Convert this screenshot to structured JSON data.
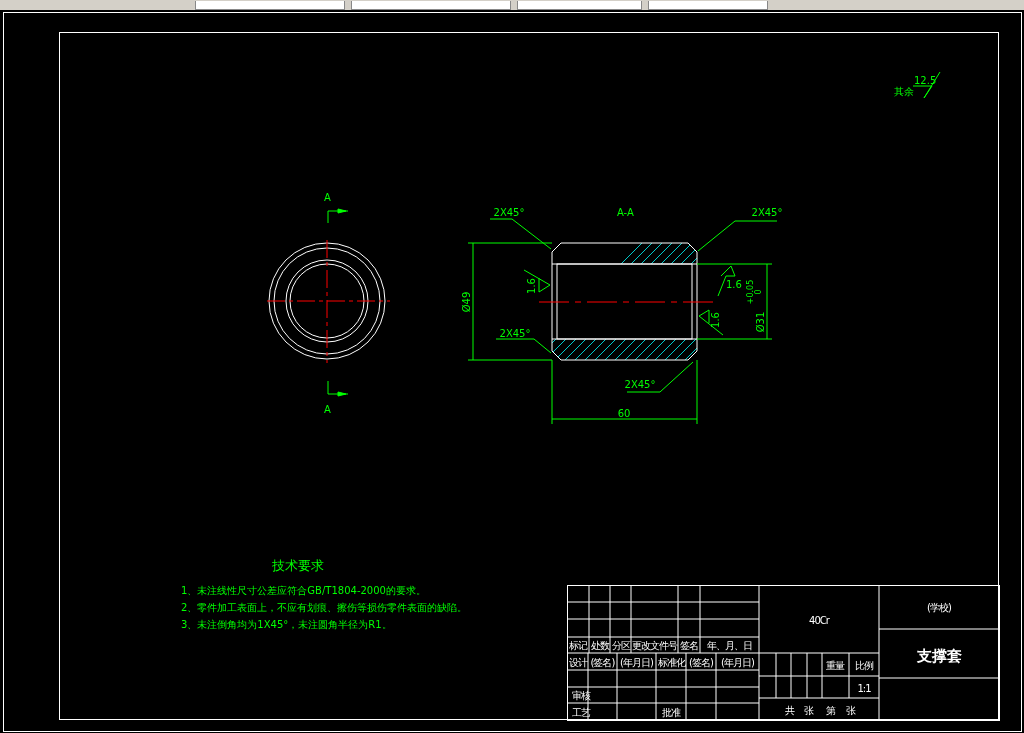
{
  "drawing": {
    "end_view": {
      "cut_labels": [
        "A",
        "A"
      ]
    },
    "section_view": {
      "title": "A-A",
      "chamfers": [
        "2X45°",
        "2X45°",
        "2X45°",
        "2X45°"
      ],
      "outer_diameter": "Ø49",
      "bore_diameter": "Ø31",
      "bore_tolerance_upper": "+0.05",
      "bore_tolerance_lower": "0",
      "length": "60",
      "roughness": [
        "1.6",
        "1.6",
        "1.6"
      ]
    },
    "general_roughness": {
      "label": "其余",
      "value": "12.5"
    }
  },
  "notes": {
    "title": "技术要求",
    "items": [
      "1、未注线性尺寸公差应符合GB/T1804-2000的要求。",
      "2、零件加工表面上，不应有划痕、擦伤等损伤零件表面的缺陷。",
      "3、未注倒角均为1X45°，未注圆角半径为R1。"
    ]
  },
  "title_block": {
    "revision_header": [
      "标记",
      "处数",
      "分区",
      "更改文件号",
      "签名",
      "年、月、日"
    ],
    "design_row": [
      "设计",
      "(签名)",
      "(年月日)",
      "标准化",
      "(签名)",
      "(年月日)"
    ],
    "review_label": "审核",
    "process_label": "工艺",
    "approve_label": "批准",
    "material": "40Cr",
    "weight_label": "重量",
    "scale_label": "比例",
    "scale": "1:1",
    "sheets": [
      "共",
      "张",
      "第",
      "张"
    ],
    "school": "(学校)",
    "part_name": "支撑套"
  }
}
